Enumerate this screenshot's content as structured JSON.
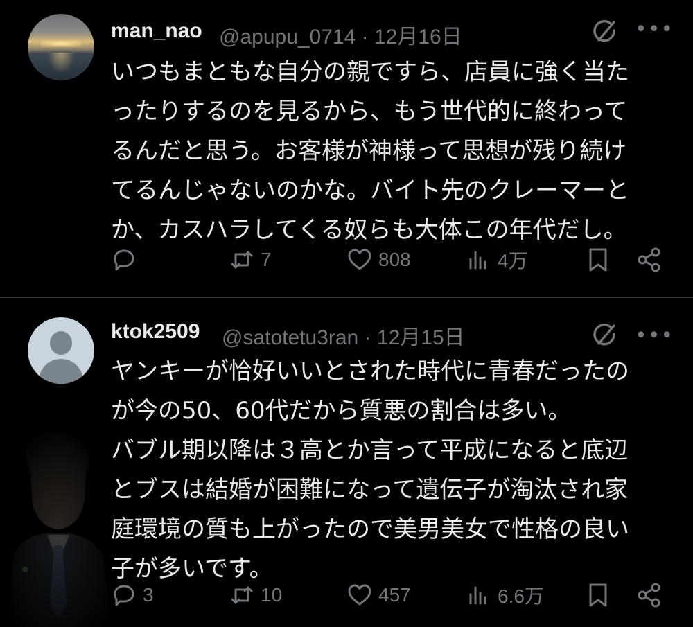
{
  "tweets": [
    {
      "display_name": "man_nao",
      "handle_date": "@apupu_0714 · 12月16日",
      "text_lines": [
        "いつもまともな自分の親ですら、店員に強く当た",
        "ったりするのを見るから、もう世代的に終わって",
        "るんだと思う。お客様が神様って思想が残り続け",
        "てるんじゃないのかな。バイト先のクレーマーと",
        "か、カスハラしてくる奴らも大体この年代だし。"
      ],
      "reply_count": "",
      "retweet_count": "7",
      "like_count": "808",
      "view_count": "4万"
    },
    {
      "display_name": "ktok2509",
      "handle_date": "@satotetu3ran · 12月15日",
      "text_lines": [
        "ヤンキーが恰好いいとされた時代に青春だったの",
        "が今の50、60代だから質悪の割合は多い。",
        "バブル期以降は３高とか言って平成になると底辺",
        "とブスは結婚が困難になって遺伝子が淘汰され家",
        "庭環境の質も上がったので美男美女で性格の良い",
        "子が多いです。"
      ],
      "reply_count": "3",
      "retweet_count": "10",
      "like_count": "457",
      "view_count": "6.6万"
    }
  ],
  "more_label": "•••",
  "icon_names": [
    "grok-icon",
    "more-icon",
    "reply-icon",
    "retweet-icon",
    "like-icon",
    "views-icon",
    "bookmark-icon",
    "share-icon"
  ],
  "colors": {
    "background": "#000000",
    "text": "#e7e9ea",
    "muted": "#71767b",
    "divider": "#2f3336"
  }
}
